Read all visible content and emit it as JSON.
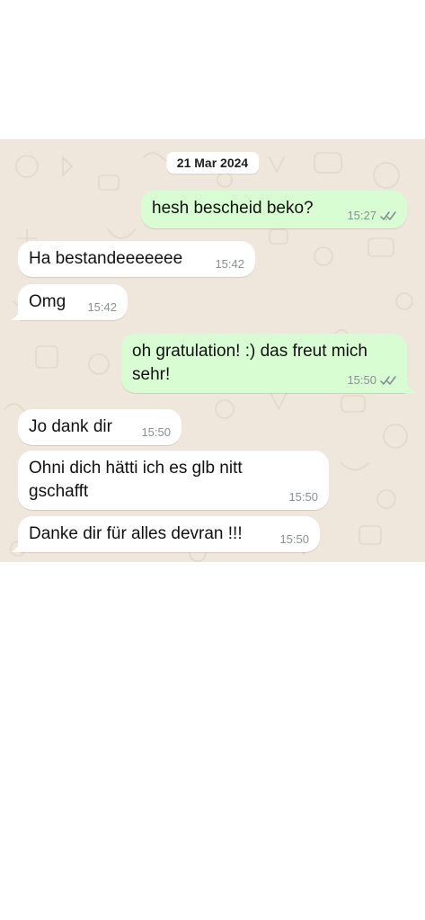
{
  "chat": {
    "date_separator": "21 Mar 2024",
    "messages": [
      {
        "direction": "outgoing",
        "text": "hesh bescheid beko?",
        "time": "15:27",
        "status": "read-icon"
      },
      {
        "direction": "incoming",
        "text": "Ha bestandeeeeeee",
        "time": "15:42"
      },
      {
        "direction": "incoming",
        "text": "Omg",
        "time": "15:42"
      },
      {
        "direction": "outgoing",
        "text": "oh gratulation! :) das freut mich sehr!",
        "time": "15:50",
        "status": "read-icon"
      },
      {
        "direction": "incoming",
        "text": "Jo dank dir",
        "time": "15:50"
      },
      {
        "direction": "incoming",
        "text": "Ohni dich hätti ich es glb nitt gschafft",
        "time": "15:50"
      },
      {
        "direction": "incoming",
        "text": "Danke dir für alles devran !!!",
        "time": "15:50"
      }
    ]
  },
  "colors": {
    "wallpaper": "#efe7dc",
    "incoming_bubble": "#ffffff",
    "outgoing_bubble": "#d9fdd3",
    "read_ticks": "#7f8a8f"
  }
}
